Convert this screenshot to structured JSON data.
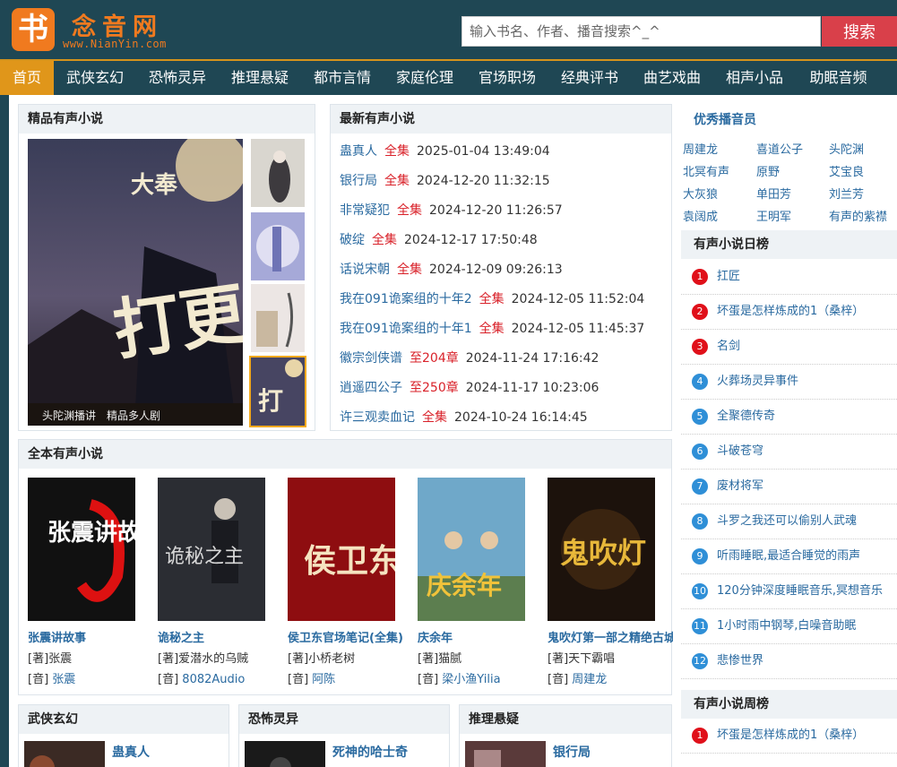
{
  "header": {
    "logo_char": "书",
    "site_name": "念音网",
    "site_url": "www.NianYin.com",
    "search_placeholder": "输入书名、作者、播音搜索^_^",
    "search_button": "搜索"
  },
  "nav": [
    {
      "label": "首页",
      "active": true
    },
    {
      "label": "武侠玄幻"
    },
    {
      "label": "恐怖灵异"
    },
    {
      "label": "推理悬疑"
    },
    {
      "label": "都市言情"
    },
    {
      "label": "家庭伦理"
    },
    {
      "label": "官场职场"
    },
    {
      "label": "经典评书"
    },
    {
      "label": "曲艺戏曲"
    },
    {
      "label": "相声小品"
    },
    {
      "label": "助眠音频"
    }
  ],
  "featured": {
    "title": "精品有声小说",
    "cover_main_title": "打更人",
    "cover_main_badge": "大奉",
    "cover_main_bottom": "头陀渊播讲　精品多人剧"
  },
  "latest": {
    "title": "最新有声小说",
    "items": [
      {
        "name": "蛊真人",
        "status": "全集",
        "date": "2025-01-04 13:49:04"
      },
      {
        "name": "银行局",
        "status": "全集",
        "date": "2024-12-20 11:32:15"
      },
      {
        "name": "非常疑犯",
        "status": "全集",
        "date": "2024-12-20 11:26:57"
      },
      {
        "name": "破绽",
        "status": "全集",
        "date": "2024-12-17 17:50:48"
      },
      {
        "name": "话说宋朝",
        "status": "全集",
        "date": "2024-12-09 09:26:13"
      },
      {
        "name": "我在091诡案组的十年2",
        "status": "全集",
        "date": "2024-12-05 11:52:04"
      },
      {
        "name": "我在091诡案组的十年1",
        "status": "全集",
        "date": "2024-12-05 11:45:37"
      },
      {
        "name": "徽宗剑侠谱",
        "status": "至204章",
        "date": "2024-11-24 17:16:42"
      },
      {
        "name": "逍遥四公子",
        "status": "至250章",
        "date": "2024-11-17 10:23:06"
      },
      {
        "name": "许三观卖血记",
        "status": "全集",
        "date": "2024-10-24 16:14:45"
      }
    ]
  },
  "complete": {
    "title": "全本有声小说",
    "author_prefix": "[著]",
    "narrator_prefix": "[音]",
    "items": [
      {
        "name": "张震讲故事",
        "author": "张震",
        "narrator": "张震",
        "cover_text": "张震讲故事"
      },
      {
        "name": "诡秘之主",
        "author": "爱潜水的乌贼",
        "narrator": "8082Audio",
        "cover_text": "诡秘之主"
      },
      {
        "name": "侯卫东官场笔记(全集)",
        "author": "小桥老树",
        "narrator": "阿陈",
        "cover_text": "侯卫东"
      },
      {
        "name": "庆余年",
        "author": "猫腻",
        "narrator": "梁小渔Yilia",
        "cover_text": "庆余年"
      },
      {
        "name": "鬼吹灯第一部之精绝古城",
        "author": "天下霸唱",
        "narrator": "周建龙",
        "cover_text": "鬼吹灯"
      }
    ]
  },
  "categories": [
    {
      "title": "武侠玄幻",
      "first": "蛊真人"
    },
    {
      "title": "恐怖灵异",
      "first": "死神的哈士奇"
    },
    {
      "title": "推理悬疑",
      "first": "银行局"
    }
  ],
  "sidebar": {
    "anchors_title": "优秀播音员",
    "anchors": [
      "周建龙",
      "喜道公子",
      "头陀渊",
      "北冥有声",
      "原野",
      "艾宝良",
      "大灰狼",
      "单田芳",
      "刘兰芳",
      "袁阔成",
      "王明军",
      "有声的紫襟"
    ],
    "daily_title": "有声小说日榜",
    "daily": [
      "扛匠",
      "坏蛋是怎样炼成的1（桑梓）",
      "名剑",
      "火葬场灵异事件",
      "全聚德传奇",
      "斗破苍穹",
      "废材将军",
      "斗罗之我还可以偷别人武魂",
      "听雨睡眠,最适合睡觉的雨声",
      "120分钟深度睡眠音乐,冥想音乐",
      "1小时雨中钢琴,白噪音助眠",
      "悲惨世界"
    ],
    "weekly_title": "有声小说周榜",
    "weekly": [
      "坏蛋是怎样炼成的1（桑梓）"
    ]
  }
}
